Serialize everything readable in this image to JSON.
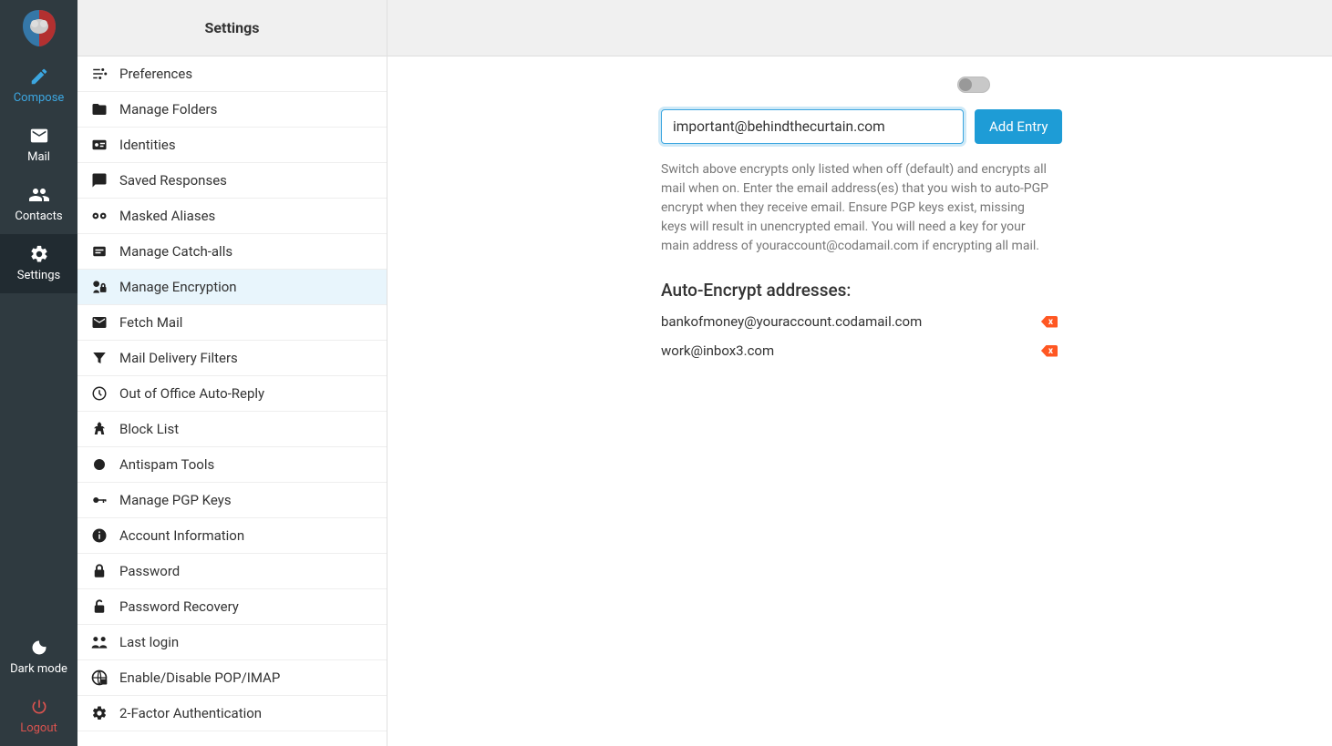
{
  "sidebar": {
    "compose": "Compose",
    "mail": "Mail",
    "contacts": "Contacts",
    "settings": "Settings",
    "dark": "Dark mode",
    "logout": "Logout"
  },
  "settingsHeader": "Settings",
  "settingsItems": [
    {
      "id": "preferences",
      "label": "Preferences"
    },
    {
      "id": "folders",
      "label": "Manage Folders"
    },
    {
      "id": "identities",
      "label": "Identities"
    },
    {
      "id": "responses",
      "label": "Saved Responses"
    },
    {
      "id": "aliases",
      "label": "Masked Aliases"
    },
    {
      "id": "catchalls",
      "label": "Manage Catch-alls"
    },
    {
      "id": "encryption",
      "label": "Manage Encryption"
    },
    {
      "id": "fetch",
      "label": "Fetch Mail"
    },
    {
      "id": "filters",
      "label": "Mail Delivery Filters"
    },
    {
      "id": "outofoffice",
      "label": "Out of Office Auto-Reply"
    },
    {
      "id": "blocklist",
      "label": "Block List"
    },
    {
      "id": "antispam",
      "label": "Antispam Tools"
    },
    {
      "id": "pgpkeys",
      "label": "Manage PGP Keys"
    },
    {
      "id": "account",
      "label": "Account Information"
    },
    {
      "id": "password",
      "label": "Password"
    },
    {
      "id": "recovery",
      "label": "Password Recovery"
    },
    {
      "id": "lastlogin",
      "label": "Last login"
    },
    {
      "id": "popimap",
      "label": "Enable/Disable POP/IMAP"
    },
    {
      "id": "twofa",
      "label": "2-Factor Authentication"
    }
  ],
  "selected": "encryption",
  "main": {
    "input_value": "important@behindthecurtain.com",
    "add_label": "Add Entry",
    "description": "Switch above encrypts only listed when off (default) and encrypts all mail when on. Enter the email address(es) that you wish to auto-PGP encrypt when they receive email. Ensure PGP keys exist, missing keys will result in unencrypted email. You will need a key for your main address of youraccount@codamail.com if encrypting all mail.",
    "section_title": "Auto-Encrypt addresses:",
    "addresses": [
      {
        "email": "bankofmoney@youraccount.codamail.com"
      },
      {
        "email": "work@inbox3.com"
      }
    ],
    "delete_label": "x"
  }
}
